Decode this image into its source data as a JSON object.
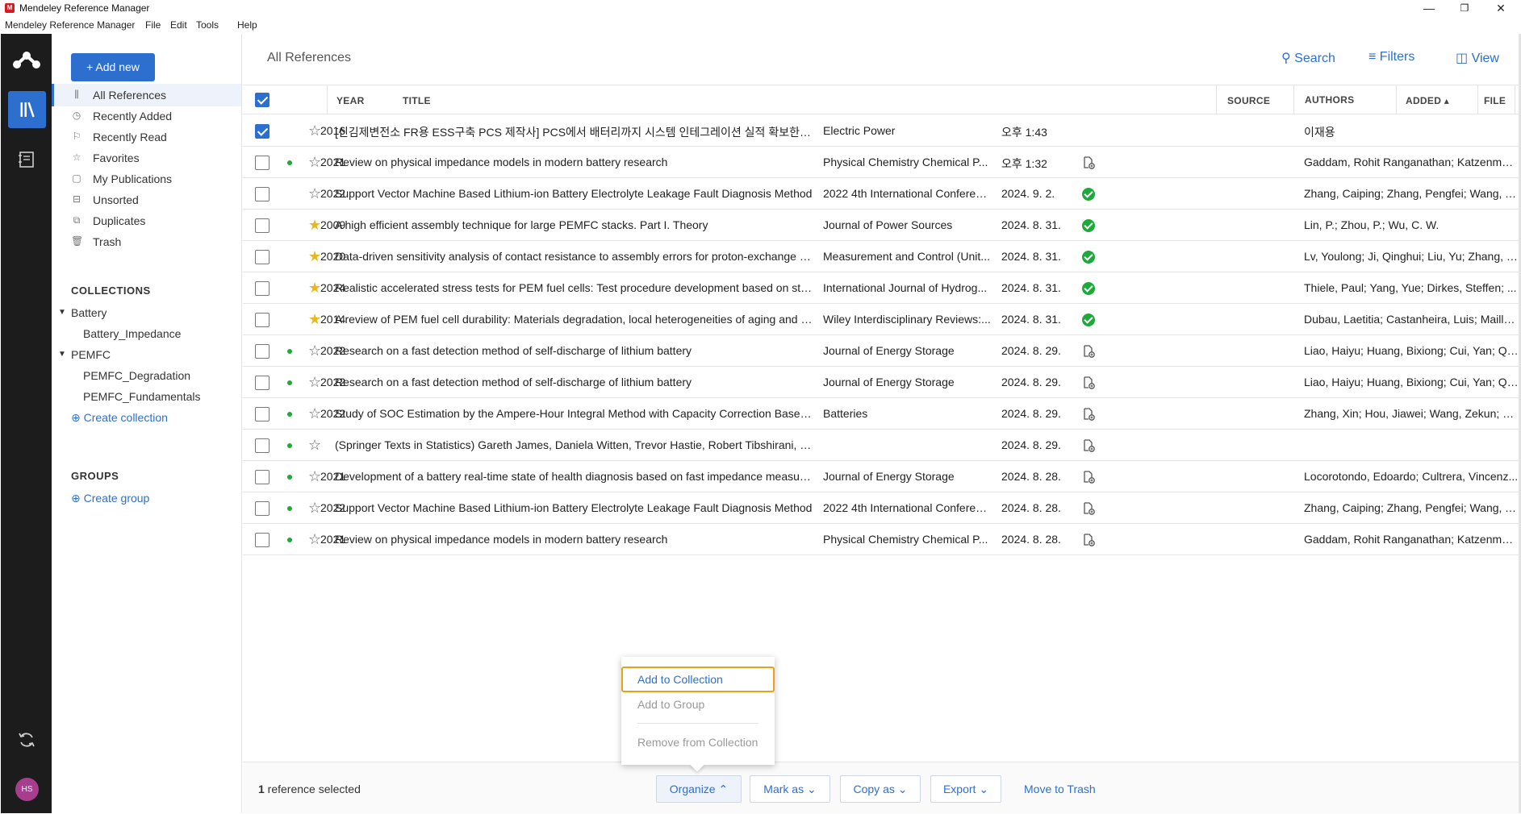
{
  "window": {
    "title": "Mendeley Reference Manager",
    "logo_text": "M",
    "minimize": "—",
    "maximize": "❐",
    "close": "✕"
  },
  "menu": [
    "Mendeley Reference Manager",
    "File",
    "Edit",
    "Tools",
    "Help"
  ],
  "rail": {
    "avatar_initials": "HS"
  },
  "sidebar": {
    "add_new_label": "+ Add new",
    "nav": [
      {
        "label": "All References",
        "icon": "library-icon"
      },
      {
        "label": "Recently Added",
        "icon": "clock-icon"
      },
      {
        "label": "Recently Read",
        "icon": "bookmark-icon"
      },
      {
        "label": "Favorites",
        "icon": "star-icon"
      },
      {
        "label": "My Publications",
        "icon": "document-icon"
      },
      {
        "label": "Unsorted",
        "icon": "inbox-icon"
      },
      {
        "label": "Duplicates",
        "icon": "duplicate-icon"
      },
      {
        "label": "Trash",
        "icon": "trash-icon"
      }
    ],
    "collections_heading": "COLLECTIONS",
    "collections": [
      {
        "label": "Battery",
        "children": [
          "Battery_Impedance"
        ]
      },
      {
        "label": "PEMFC",
        "children": [
          "PEMFC_Degradation",
          "PEMFC_Fundamentals"
        ]
      }
    ],
    "create_collection": "Create collection",
    "groups_heading": "GROUPS",
    "create_group": "Create group"
  },
  "main": {
    "title": "All References",
    "toolbar": {
      "search": "Search",
      "filters": "Filters",
      "view": "View"
    },
    "columns": {
      "year": "YEAR",
      "title": "TITLE",
      "source": "SOURCE",
      "added": "ADDED ▴",
      "file": "FILE",
      "authors": "AUTHORS"
    },
    "rows": [
      {
        "checked": true,
        "unread": false,
        "fav": false,
        "year": "2016",
        "title": "[신김제변전소 FR용 ESS구축 PCS 제작사] PCS에서 배터리까지 시스템 인테그레이션 실적 확보한 '우진산전'",
        "source": "Electric Power",
        "added": "오후 1:43",
        "file": "none",
        "authors": "이재용"
      },
      {
        "checked": false,
        "unread": true,
        "fav": false,
        "year": "2021",
        "title": "Review on physical impedance models in modern battery research",
        "source": "Physical Chemistry Chemical P...",
        "added": "오후 1:32",
        "file": "add",
        "authors": "Gaddam, Rohit Ranganathan; Katzenmei..."
      },
      {
        "checked": false,
        "unread": false,
        "fav": false,
        "year": "2022",
        "title": "Support Vector Machine Based Lithium-ion Battery Electrolyte Leakage Fault Diagnosis Method",
        "source": "2022 4th International Conferen...",
        "added": "2024. 9. 2.",
        "file": "ok",
        "authors": "Zhang, Caiping; Zhang, Pengfei; Wang, Y..."
      },
      {
        "checked": false,
        "unread": false,
        "fav": true,
        "year": "2009",
        "title": "A high efficient assembly technique for large PEMFC stacks. Part I. Theory",
        "source": "Journal of Power Sources",
        "added": "2024. 8. 31.",
        "file": "ok",
        "authors": "Lin, P.; Zhou, P.; Wu, C. W."
      },
      {
        "checked": false,
        "unread": false,
        "fav": true,
        "year": "2020",
        "title": "Data-driven sensitivity analysis of contact resistance to assembly errors for proton-exchange membrane fuel cells",
        "source": "Measurement and Control (Unit...",
        "added": "2024. 8. 31.",
        "file": "ok",
        "authors": "Lv, Youlong; Ji, Qinghui; Liu, Yu; Zhang, Jie"
      },
      {
        "checked": false,
        "unread": false,
        "fav": true,
        "year": "2024",
        "title": "Realistic accelerated stress tests for PEM fuel cells: Test procedure development based on standardized automoti...",
        "source": "International Journal of Hydrog...",
        "added": "2024. 8. 31.",
        "file": "ok",
        "authors": "Thiele, Paul; Yang, Yue; Dirkes, Steffen; ..."
      },
      {
        "checked": false,
        "unread": false,
        "fav": true,
        "year": "2014",
        "title": "A review of PEM fuel cell durability: Materials degradation, local heterogeneities of aging and possible mitigation st...",
        "source": "Wiley Interdisciplinary Reviews:...",
        "added": "2024. 8. 31.",
        "file": "ok",
        "authors": "Dubau, Laetitia; Castanheira, Luis; Mailla..."
      },
      {
        "checked": false,
        "unread": true,
        "fav": false,
        "year": "2022",
        "title": "Research on a fast detection method of self-discharge of lithium battery",
        "source": "Journal of Energy Storage",
        "added": "2024. 8. 29.",
        "file": "add",
        "authors": "Liao, Haiyu; Huang, Bixiong; Cui, Yan; Qi..."
      },
      {
        "checked": false,
        "unread": true,
        "fav": false,
        "year": "2022",
        "title": "Research on a fast detection method of self-discharge of lithium battery",
        "source": "Journal of Energy Storage",
        "added": "2024. 8. 29.",
        "file": "add",
        "authors": "Liao, Haiyu; Huang, Bixiong; Cui, Yan; Qi..."
      },
      {
        "checked": false,
        "unread": true,
        "fav": false,
        "year": "2022",
        "title": "Study of SOC Estimation by the Ampere-Hour Integral Method with Capacity Correction Based on LSTM",
        "source": "Batteries",
        "added": "2024. 8. 29.",
        "file": "add",
        "authors": "Zhang, Xin; Hou, Jiawei; Wang, Zekun; Ji..."
      },
      {
        "checked": false,
        "unread": true,
        "fav": false,
        "year": "",
        "title": "(Springer Texts in Statistics) Gareth James, Daniela Witten, Trevor Hastie, Robert Tibshirani, Jonathan Taylor - An ...",
        "source": "",
        "added": "2024. 8. 29.",
        "file": "add",
        "authors": ""
      },
      {
        "checked": false,
        "unread": true,
        "fav": false,
        "year": "2021",
        "title": "Development of a battery real-time state of health diagnosis based on fast impedance measurements",
        "source": "Journal of Energy Storage",
        "added": "2024. 8. 28.",
        "file": "add",
        "authors": "Locorotondo, Edoardo; Cultrera, Vincenz..."
      },
      {
        "checked": false,
        "unread": true,
        "fav": false,
        "year": "2022",
        "title": "Support Vector Machine Based Lithium-ion Battery Electrolyte Leakage Fault Diagnosis Method",
        "source": "2022 4th International Conferen...",
        "added": "2024. 8. 28.",
        "file": "add",
        "authors": "Zhang, Caiping; Zhang, Pengfei; Wang, Y..."
      },
      {
        "checked": false,
        "unread": true,
        "fav": false,
        "year": "2021",
        "title": "Review on physical impedance models in modern battery research",
        "source": "Physical Chemistry Chemical P...",
        "added": "2024. 8. 28.",
        "file": "add",
        "authors": "Gaddam, Rohit Ranganathan; Katzenmei..."
      }
    ]
  },
  "actionbar": {
    "count": "1",
    "count_suffix": " reference selected",
    "organize": "Organize",
    "mark_as": "Mark as",
    "copy_as": "Copy as",
    "export": "Export",
    "move_to_trash": "Move to Trash"
  },
  "popup": {
    "add_to_collection": "Add to Collection",
    "add_to_group": "Add to Group",
    "remove_from_collection": "Remove from Collection"
  },
  "colors": {
    "accent": "#2c6fcf",
    "unread_dot": "#1eaa3a",
    "favorite": "#e6b71e",
    "focus_ring": "#e6a11e"
  }
}
